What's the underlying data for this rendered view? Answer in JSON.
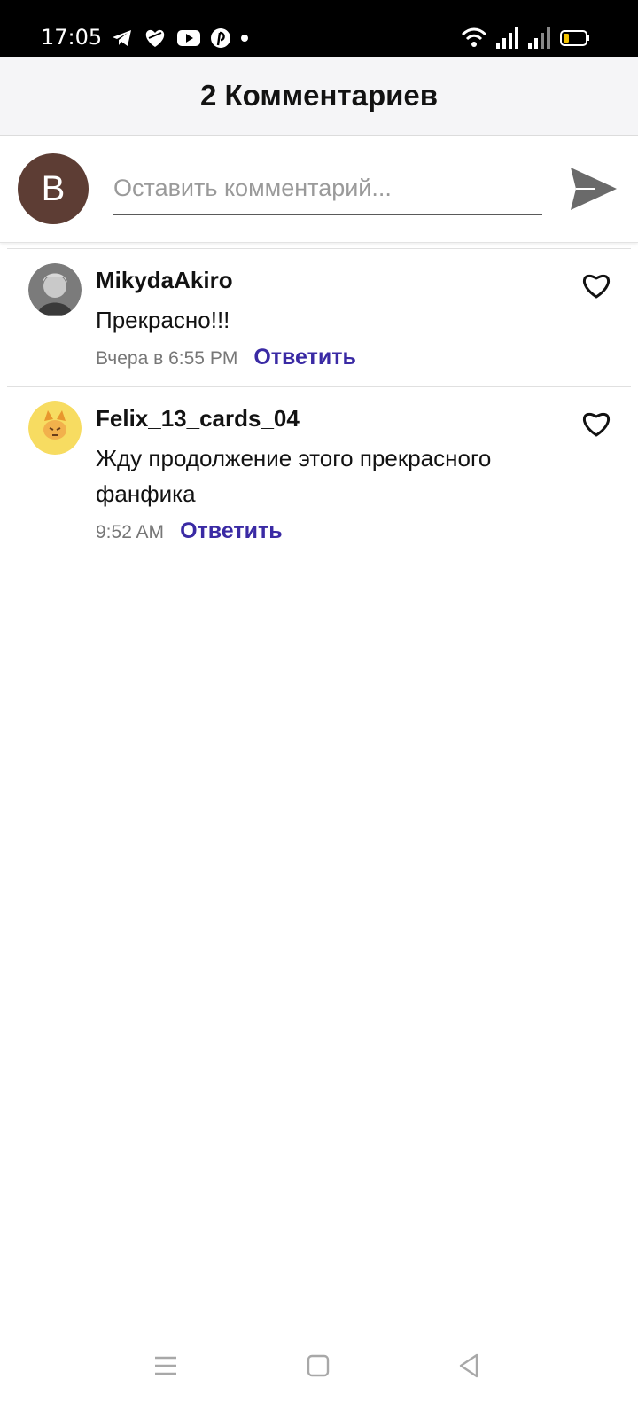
{
  "status_bar": {
    "time": "17:05",
    "left_icons": [
      "telegram-icon",
      "heart-icon",
      "youtube-icon",
      "pinterest-icon",
      "dot-icon"
    ],
    "right_icons": [
      "wifi-icon",
      "signal-icon",
      "signal-icon",
      "battery-icon"
    ]
  },
  "header": {
    "title": "2 Комментариев"
  },
  "composer": {
    "avatar_letter": "B",
    "placeholder": "Оставить комментарий...",
    "value": "",
    "send_icon": "send-icon"
  },
  "comments": [
    {
      "username": "MikydaAkiro",
      "text": "Прекрасно!!!",
      "time": "Вчера в 6:55 PM",
      "reply_label": "Ответить",
      "like_icon": "heart-outline-icon"
    },
    {
      "username": "Felix_13_cards_04",
      "text": "Жду продолжение этого прекрасного фанфика",
      "time": "9:52 AM",
      "reply_label": "Ответить",
      "like_icon": "heart-outline-icon"
    }
  ],
  "nav_bar": {
    "icons": [
      "menu-icon",
      "home-icon",
      "back-icon"
    ]
  },
  "colors": {
    "accent": "#3a2aa4",
    "avatar_bg": "#5d3d34",
    "header_bg": "#f5f5f7"
  }
}
